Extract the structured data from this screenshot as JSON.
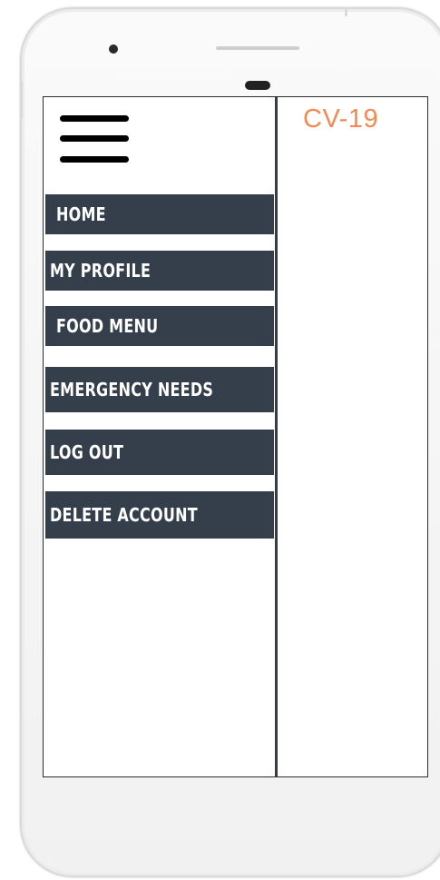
{
  "app": {
    "brand_title": "CV-19",
    "brand_color": "#f5894f"
  },
  "device": {
    "camera_icon": "front-camera",
    "speaker_icon": "earpiece-speaker",
    "sensor_icon": "proximity-sensor"
  },
  "menu": {
    "toggle_icon": "hamburger-menu-icon",
    "items": [
      {
        "label": "HOME"
      },
      {
        "label": "MY PROFILE"
      },
      {
        "label": "FOOD MENU"
      },
      {
        "label": "EMERGENCY NEEDS"
      },
      {
        "label": "LOG OUT"
      },
      {
        "label": "DELETE ACCOUNT"
      }
    ],
    "item_color": "#353e4b",
    "text_color": "#ffffff"
  }
}
